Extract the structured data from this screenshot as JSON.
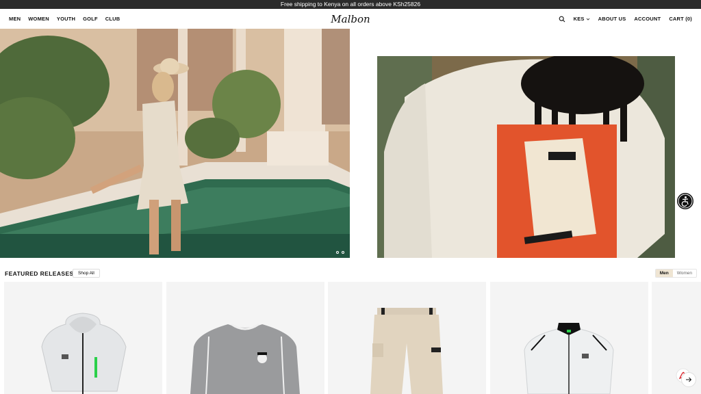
{
  "announcement": "Free shipping to Kenya on all orders above KSh25826",
  "nav": {
    "left": [
      "MEN",
      "WOMEN",
      "YOUTH",
      "GOLF",
      "CLUB"
    ],
    "logo": "Malbon",
    "currency": "KES",
    "about": "ABOUT US",
    "account": "ACCOUNT",
    "cart": "CART (0)"
  },
  "featured": {
    "title": "FEATURED RELEASES",
    "shop_all": "Shop All",
    "toggle": [
      "Men",
      "Women"
    ],
    "selected": "Men"
  },
  "colors": {
    "announce_bg": "#2b2b2b",
    "card_bg": "#f4f4f4",
    "toggle_active": "#efe5d3",
    "tile_green": "#2f6b4f",
    "shirt_red": "#e2542c"
  },
  "icons": [
    "search-icon",
    "chevron-down-icon",
    "accessibility-icon",
    "arrow-right-icon",
    "pdf-icon"
  ]
}
